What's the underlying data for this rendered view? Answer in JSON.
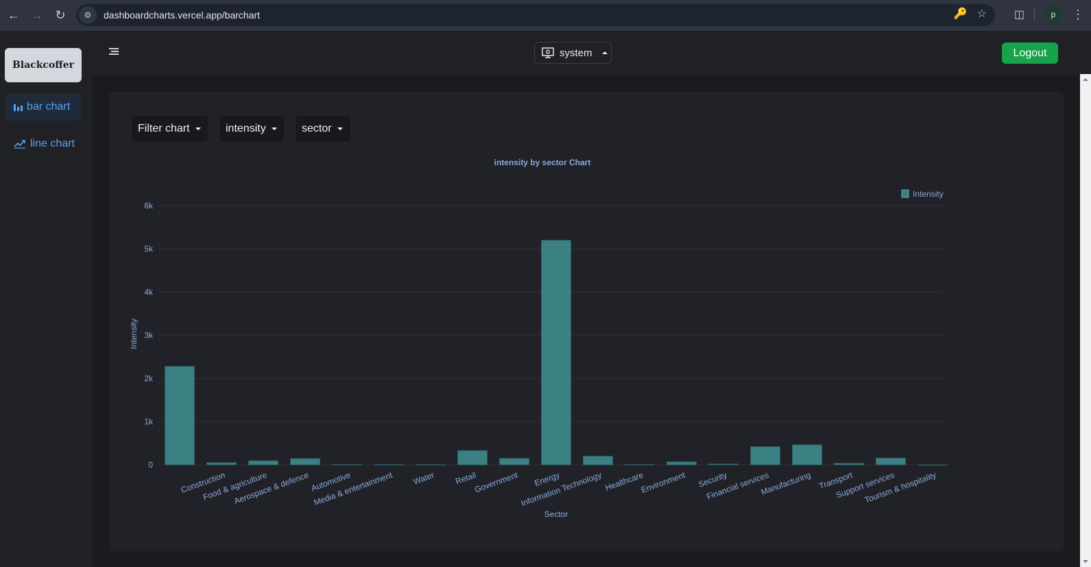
{
  "browser": {
    "url": "dashboardcharts.vercel.app/barchart",
    "profile_initial": "p"
  },
  "sidebar": {
    "logo": "Blackcoffer",
    "items": [
      {
        "label": "bar chart",
        "icon": "bar-chart-icon",
        "active": true
      },
      {
        "label": "line chart",
        "icon": "line-chart-icon",
        "active": false
      }
    ]
  },
  "topbar": {
    "theme_label": "system",
    "logout_label": "Logout"
  },
  "filters": {
    "filter_chart_label": "Filter chart",
    "metric_label": "intensity",
    "dimension_label": "sector"
  },
  "colors": {
    "bar": "#3b8083",
    "bar_edge": "#46b0c0",
    "logout": "#16a34a",
    "link": "#5aa2f0"
  },
  "chart_data": {
    "type": "bar",
    "title": "intensity by sector Chart",
    "xlabel": "Sector",
    "ylabel": "Intensity",
    "legend": {
      "entries": [
        "Intensity"
      ],
      "position": "top-right"
    },
    "categories": [
      "",
      "Construction",
      "Food & agriculture",
      "Aerospace & defence",
      "Automotive",
      "Media & entertainment",
      "Water",
      "Retail",
      "Government",
      "Energy",
      "Information Technology",
      "Healthcare",
      "Environment",
      "Security",
      "Financial services",
      "Manufacturing",
      "Transport",
      "Support services",
      "Tourism & hospitality"
    ],
    "series": [
      {
        "name": "Intensity",
        "values": [
          2280,
          50,
          95,
          145,
          10,
          5,
          5,
          330,
          150,
          5200,
          200,
          5,
          70,
          20,
          420,
          465,
          35,
          155,
          0
        ]
      }
    ],
    "ylim": [
      0,
      6000
    ],
    "yticks": [
      0,
      1000,
      2000,
      3000,
      4000,
      5000,
      6000
    ],
    "ytick_labels": [
      "0",
      "1k",
      "2k",
      "3k",
      "4k",
      "5k",
      "6k"
    ],
    "grid": true
  }
}
